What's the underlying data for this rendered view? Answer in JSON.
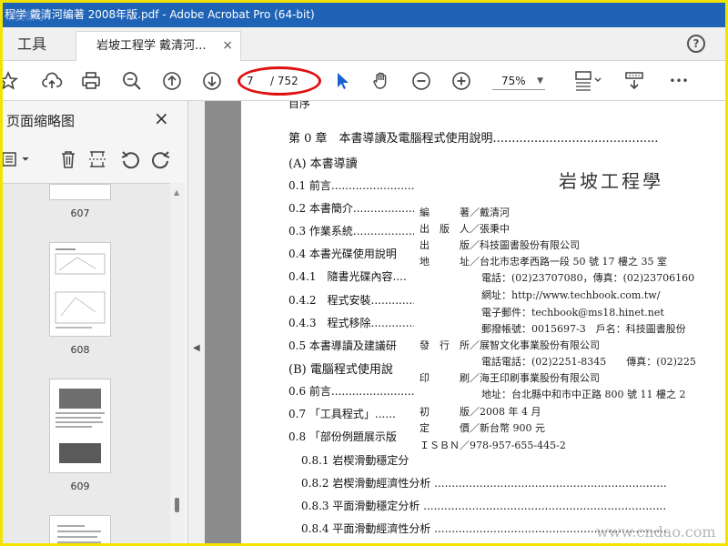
{
  "window": {
    "title": "程学 戴清河编著 2008年版.pdf - Adobe Acrobat Pro (64-bit)"
  },
  "tabs": {
    "tools_label": "工具",
    "document_label": "岩坡工程学 戴清河...",
    "close_glyph": "×",
    "help_glyph": "?"
  },
  "toolbar": {
    "current_page": "7",
    "total_pages": "/ 752",
    "zoom": "75%",
    "more_glyph": "•••"
  },
  "sidebar": {
    "title": "页面缩略图",
    "close_glyph": "×",
    "thumbnails": [
      {
        "label": "607"
      },
      {
        "label": "608"
      },
      {
        "label": "609"
      }
    ]
  },
  "document": {
    "top_partial": "目序",
    "toc": [
      {
        "text": "第 0 章　本書導讀及電腦程式使用說明............................................"
      },
      {
        "text": "(A)  本書導讀"
      },
      {
        "text": "0.1  前言..........................................."
      },
      {
        "text": "0.2  本書簡介.................................."
      },
      {
        "text": "0.3  作業系統................................."
      },
      {
        "text": "0.4  本書光碟使用說明"
      },
      {
        "text": "0.4.1　隨書光碟內容...."
      },
      {
        "text": "0.4.2　程式安裝................"
      },
      {
        "text": "0.4.3　程式移除................"
      },
      {
        "text": "0.5  本書導讀及建議研"
      },
      {
        "text": "(B)  電腦程式使用說"
      },
      {
        "text": "0.6  前言............................................."
      },
      {
        "text": "0.7  「工具程式」......"
      },
      {
        "text": "0.8  「部份例題展示版"
      },
      {
        "text": "0.8.1  岩楔滑動穩定分"
      },
      {
        "text": "0.8.2  岩楔滑動經濟性分析 ..................................................................."
      },
      {
        "text": "0.8.3  平面滑動穩定分析 ......................................................................"
      },
      {
        "text": "0.8.4  平面滑動經濟性分析 ..................................................................."
      }
    ],
    "copyright": {
      "title": "岩坡工程學",
      "lines": [
        "編　　　著／戴清河",
        "出　版　人／張秉中",
        "出　　　版／科技圖書股份有限公司",
        "地　　　址／台北市忠孝西路一段 50 號 17 樓之 35 室",
        "電話：(02)23707080，傳真：(02)23706160",
        "網址：http://www.techbook.com.tw/",
        "電子郵件：techbook@ms18.hinet.net",
        "郵撥帳號：0015697-3　戶名：科技圖書股份",
        "發　行　所／展智文化事業股份有限公司",
        "電話電話：(02)2251-8345　　傳真：(02)225",
        "印　　　刷／海王印刷事業股份有限公司",
        "地址：台北縣中和市中正路 800 號 11 樓之 2",
        "初　　　版／2008 年 4 月",
        "定　　　價／新台幣 900 元",
        "ＩＳＢＮ／978-957-655-445-2"
      ]
    }
  },
  "watermarks": {
    "top_left": "清微网",
    "bottom_right": "www.cndao.com"
  },
  "colors": {
    "title_bar": "#1e63b6",
    "annotation_ellipse": "#e01010",
    "cursor_tool": "#1a5fd6",
    "frame_border": "#f2e400"
  }
}
